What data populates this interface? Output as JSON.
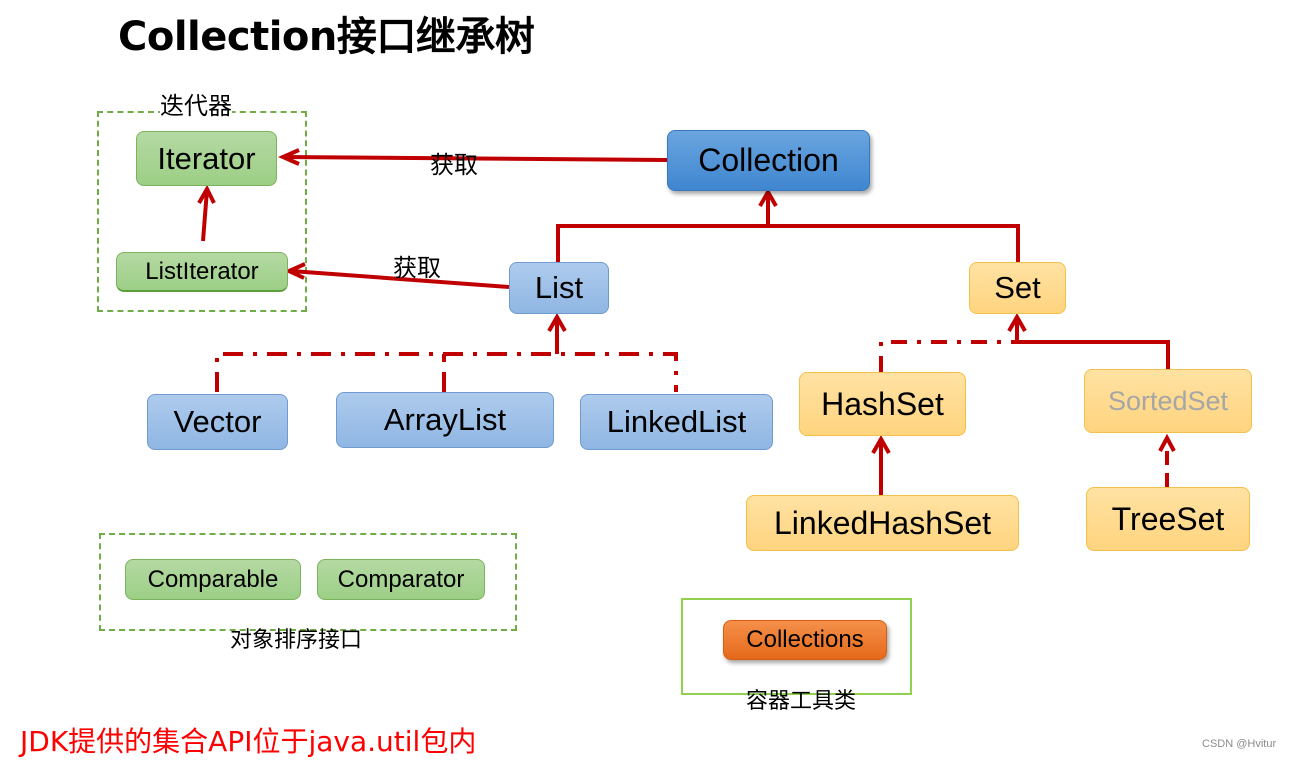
{
  "title": "Collection接口继承树",
  "groups": {
    "iterator_group_label": "迭代器",
    "sort_group_label": "对象排序接口",
    "tools_group_label": "容器工具类"
  },
  "nodes": {
    "iterator": "Iterator",
    "list_iterator": "ListIterator",
    "collection": "Collection",
    "list": "List",
    "set": "Set",
    "vector": "Vector",
    "array_list": "ArrayList",
    "linked_list": "LinkedList",
    "hash_set": "HashSet",
    "sorted_set": "SortedSet",
    "linked_hash_set": "LinkedHashSet",
    "tree_set": "TreeSet",
    "comparable": "Comparable",
    "comparator": "Comparator",
    "collections": "Collections"
  },
  "edge_labels": {
    "collection_to_iterator": "获取",
    "list_to_list_iterator": "获取"
  },
  "footer_note": "JDK提供的集合API位于java.util包内",
  "watermark": "CSDN @Hvitur",
  "colors": {
    "arrow": "#c00000",
    "footer": "#ff0000",
    "group_border": "#70ad47"
  }
}
